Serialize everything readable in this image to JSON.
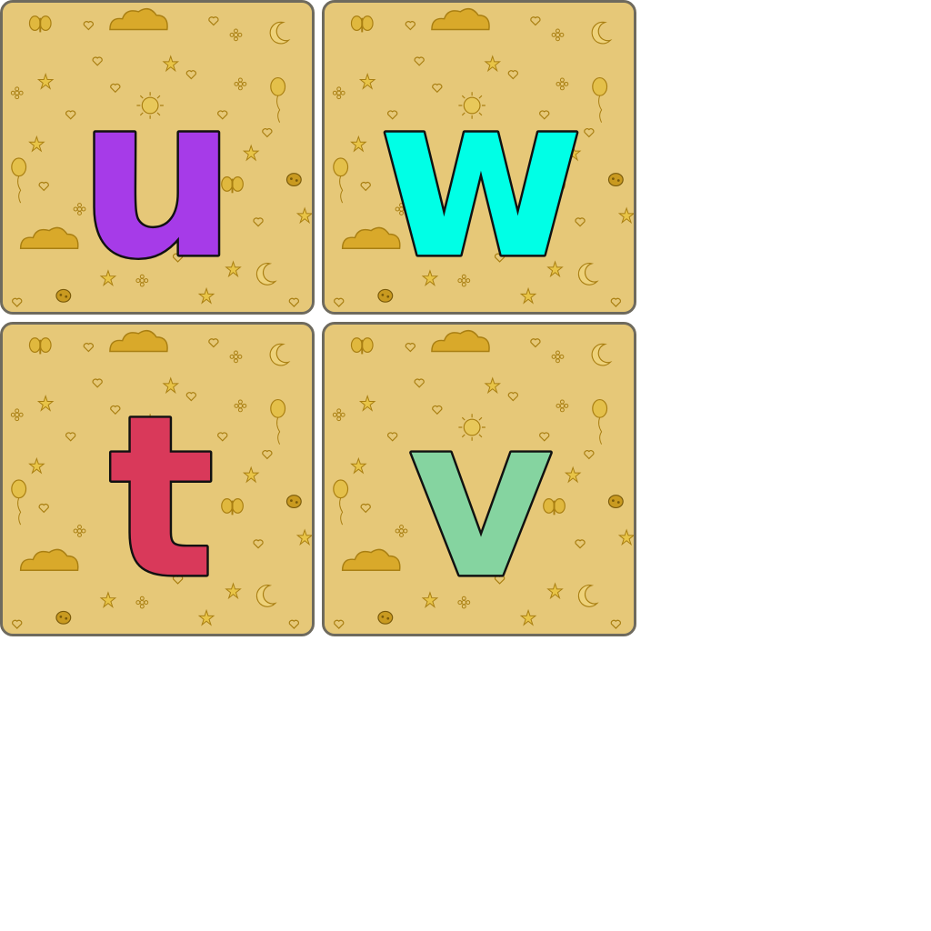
{
  "tiles": [
    {
      "letter": "u",
      "color": "#a63be8"
    },
    {
      "letter": "w",
      "color": "#00ffe6"
    },
    {
      "letter": "t",
      "color": "#d9395a"
    },
    {
      "letter": "v",
      "color": "#85d4a0"
    }
  ],
  "tile_background_color": "#e6c878",
  "doodle_color": "#c9a227",
  "doodle_icons": [
    "cloud-icon",
    "star-icon",
    "heart-icon",
    "butterfly-icon",
    "flower-icon",
    "moon-icon",
    "sun-icon",
    "balloon-icon",
    "ladybug-icon"
  ]
}
